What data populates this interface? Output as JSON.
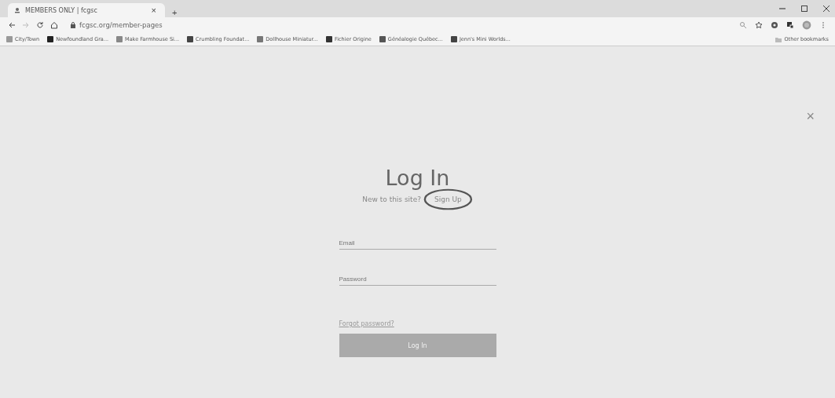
{
  "browser": {
    "tab_title": "MEMBERS ONLY | fcgsc",
    "tab_close": "×",
    "new_tab": "+",
    "url": "fcgsc.org/member-pages",
    "bookmarks": [
      "City/Town",
      "Newfoundland Gra...",
      "Make Farmhouse Si...",
      "Crumbling Foundat...",
      "Dollhouse Miniatur...",
      "Fichier Origine",
      "Généalogie Québec...",
      "Jenn's Mini Worlds..."
    ],
    "other_bookmarks": "Other bookmarks"
  },
  "dialog": {
    "close": "×",
    "title": "Log In",
    "prompt": "New to this site?",
    "signup_link": "Sign Up",
    "signup_circled": true,
    "fields": [
      {
        "placeholder": "Email"
      },
      {
        "placeholder": "Password"
      }
    ],
    "forgot_link": "Forgot password?",
    "submit": "Log In"
  }
}
